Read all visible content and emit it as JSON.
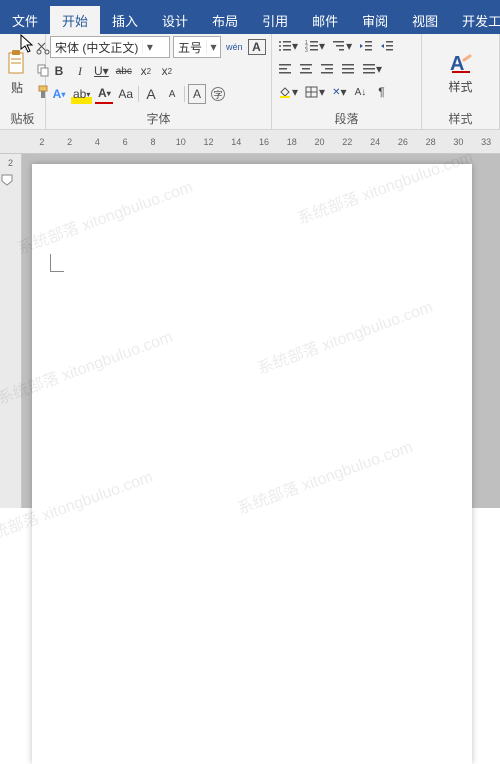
{
  "colors": {
    "brand": "#2b579a",
    "accent": "#3d8afd"
  },
  "tabs": {
    "file": "文件",
    "home": "开始",
    "insert": "插入",
    "design": "设计",
    "layout": "布局",
    "references": "引用",
    "mail": "邮件",
    "review": "审阅",
    "view": "视图",
    "developer": "开发工具"
  },
  "clipboard": {
    "group_label": "贴板"
  },
  "font": {
    "group_label": "字体",
    "family": "宋体 (中文正文)",
    "size": "五号",
    "wen": "wén",
    "bold": "B",
    "italic": "I",
    "underline": "U",
    "strike": "abc",
    "aa": "Aa",
    "grow": "A",
    "shrink": "A",
    "super": "A",
    "clear": "A"
  },
  "paragraph": {
    "group_label": "段落"
  },
  "styles": {
    "group_label": "样式",
    "label": "样式"
  },
  "ruler": {
    "marks": [
      "2",
      "2",
      "4",
      "6",
      "8",
      "10",
      "12",
      "14",
      "16",
      "18",
      "20",
      "22",
      "24",
      "26",
      "28",
      "30",
      "33"
    ]
  },
  "vruler": {
    "top": "2"
  },
  "watermark": "系统部落 xitongbuluo.com"
}
